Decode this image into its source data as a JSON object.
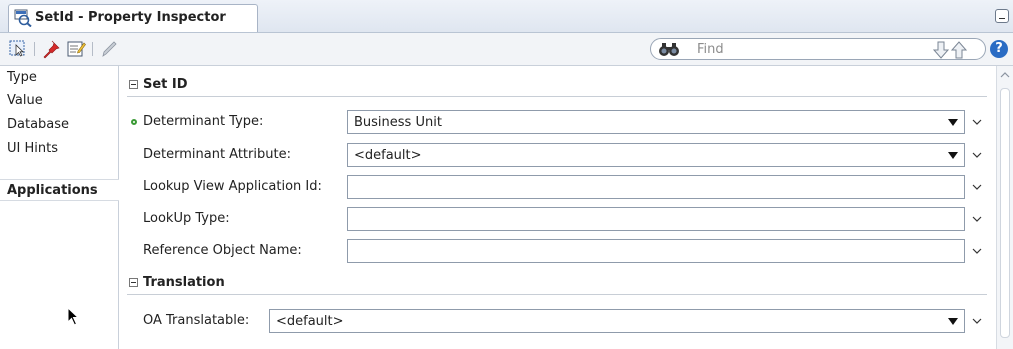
{
  "window": {
    "title": "SetId - Property Inspector",
    "tab_icon": "property-inspector-icon"
  },
  "toolbar": {
    "buttons": [
      "select-icon",
      "pin-icon",
      "edit-properties-icon",
      "pencil-icon"
    ],
    "find_placeholder": "Find"
  },
  "nav": {
    "items": [
      "Type",
      "Value",
      "Database",
      "UI Hints",
      "Applications"
    ],
    "active": "Applications"
  },
  "sections": {
    "setid": {
      "title": "Set ID",
      "fields": {
        "determinant_type": {
          "label": "Determinant Type:",
          "value": "Business Unit",
          "required": true
        },
        "determinant_attribute": {
          "label": "Determinant Attribute:",
          "value": "<default>"
        },
        "lookup_view_app_id": {
          "label": "Lookup View Application Id:",
          "value": ""
        },
        "lookup_type": {
          "label": "LookUp Type:",
          "value": ""
        },
        "reference_object_name": {
          "label": "Reference Object Name:",
          "value": ""
        }
      }
    },
    "translation": {
      "title": "Translation",
      "fields": {
        "oa_translatable": {
          "label": "OA Translatable:",
          "value": "<default>"
        }
      }
    }
  },
  "colors": {
    "required_indicator": "#3a9a35",
    "help_icon": "#2a6cc4"
  }
}
